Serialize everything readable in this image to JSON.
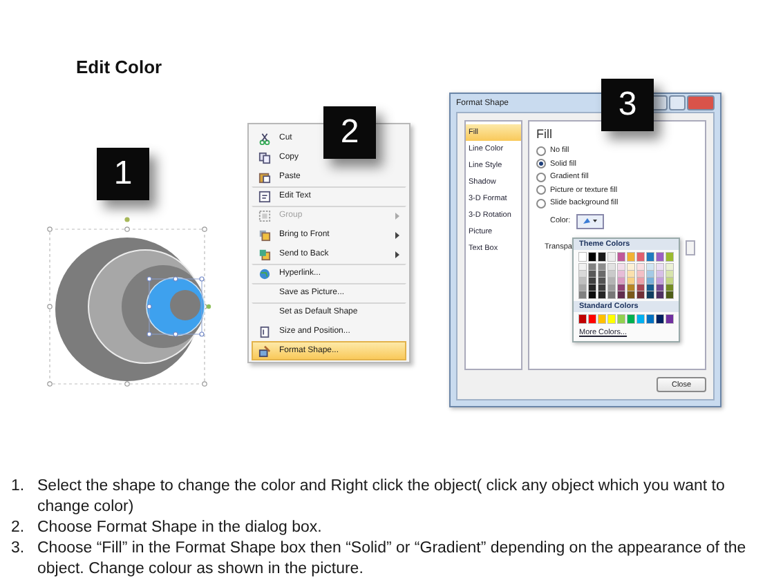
{
  "title": "Edit Color",
  "shape_panel": {
    "badge": "1"
  },
  "menu_panel": {
    "badge": "2",
    "items": [
      {
        "label": "Cut",
        "disabled": false,
        "submenu": false,
        "selected": false,
        "divider_before": false
      },
      {
        "label": "Copy",
        "disabled": false,
        "submenu": false,
        "selected": false,
        "divider_before": false
      },
      {
        "label": "Paste",
        "disabled": false,
        "submenu": false,
        "selected": false,
        "divider_before": false
      },
      {
        "label": "Edit Text",
        "disabled": false,
        "submenu": false,
        "selected": false,
        "divider_before": true
      },
      {
        "label": "Group",
        "disabled": true,
        "submenu": true,
        "selected": false,
        "divider_before": true
      },
      {
        "label": "Bring to Front",
        "disabled": false,
        "submenu": true,
        "selected": false,
        "divider_before": false
      },
      {
        "label": "Send to Back",
        "disabled": false,
        "submenu": true,
        "selected": false,
        "divider_before": false
      },
      {
        "label": "Hyperlink...",
        "disabled": false,
        "submenu": false,
        "selected": false,
        "divider_before": true
      },
      {
        "label": "Save as Picture...",
        "disabled": false,
        "submenu": false,
        "selected": false,
        "divider_before": true
      },
      {
        "label": "Set as Default Shape",
        "disabled": false,
        "submenu": false,
        "selected": false,
        "divider_before": true
      },
      {
        "label": "Size and Position...",
        "disabled": false,
        "submenu": false,
        "selected": false,
        "divider_before": false
      },
      {
        "label": "Format Shape...",
        "disabled": false,
        "submenu": false,
        "selected": true,
        "divider_before": false
      }
    ]
  },
  "dialog_panel": {
    "badge": "3",
    "window_title": "Format Shape",
    "categories": [
      {
        "label": "Fill",
        "selected": true
      },
      {
        "label": "Line Color",
        "selected": false
      },
      {
        "label": "Line Style",
        "selected": false
      },
      {
        "label": "Shadow",
        "selected": false
      },
      {
        "label": "3-D Format",
        "selected": false
      },
      {
        "label": "3-D Rotation",
        "selected": false
      },
      {
        "label": "Picture",
        "selected": false
      },
      {
        "label": "Text Box",
        "selected": false
      }
    ],
    "section_title": "Fill",
    "options": [
      {
        "label": "No fill",
        "selected": false
      },
      {
        "label": "Solid fill",
        "selected": true
      },
      {
        "label": "Gradient fill",
        "selected": false
      },
      {
        "label": "Picture or texture fill",
        "selected": false
      },
      {
        "label": "Slide background fill",
        "selected": false
      }
    ],
    "color_label": "Color:",
    "transparency_label": "Transpa",
    "palette": {
      "theme_heading": "Theme Colors",
      "theme_colors": [
        {
          "color": "#ffffff"
        },
        {
          "color": "#000000"
        },
        {
          "color": "#1a1a1a"
        },
        {
          "color": "#eeeeee"
        },
        {
          "color": "#c0589a"
        },
        {
          "color": "#f2b233"
        },
        {
          "color": "#e0606e"
        },
        {
          "color": "#1f7bbf"
        },
        {
          "color": "#9c5fc4"
        },
        {
          "color": "#9bbb30"
        }
      ],
      "standard_heading": "Standard Colors",
      "standard_colors": [
        {
          "color": "#c00000"
        },
        {
          "color": "#ff0000"
        },
        {
          "color": "#ffc000"
        },
        {
          "color": "#ffff00"
        },
        {
          "color": "#92d050"
        },
        {
          "color": "#00b050"
        },
        {
          "color": "#00b0f0"
        },
        {
          "color": "#0070c0"
        },
        {
          "color": "#002060"
        },
        {
          "color": "#7030a0"
        }
      ],
      "more_link": "More Colors..."
    },
    "close_button": "Close"
  },
  "instructions": [
    {
      "number": "1.",
      "text": "Select the shape to change the color and Right click the object( click any object which you want to change color)"
    },
    {
      "number": "2.",
      "text": "Choose Format Shape in the dialog box."
    },
    {
      "number": "3.",
      "text": "Choose “Fill” in the Format Shape box then “Solid” or “Gradient” depending on the appearance of the object. Change colour as shown in the picture."
    }
  ]
}
